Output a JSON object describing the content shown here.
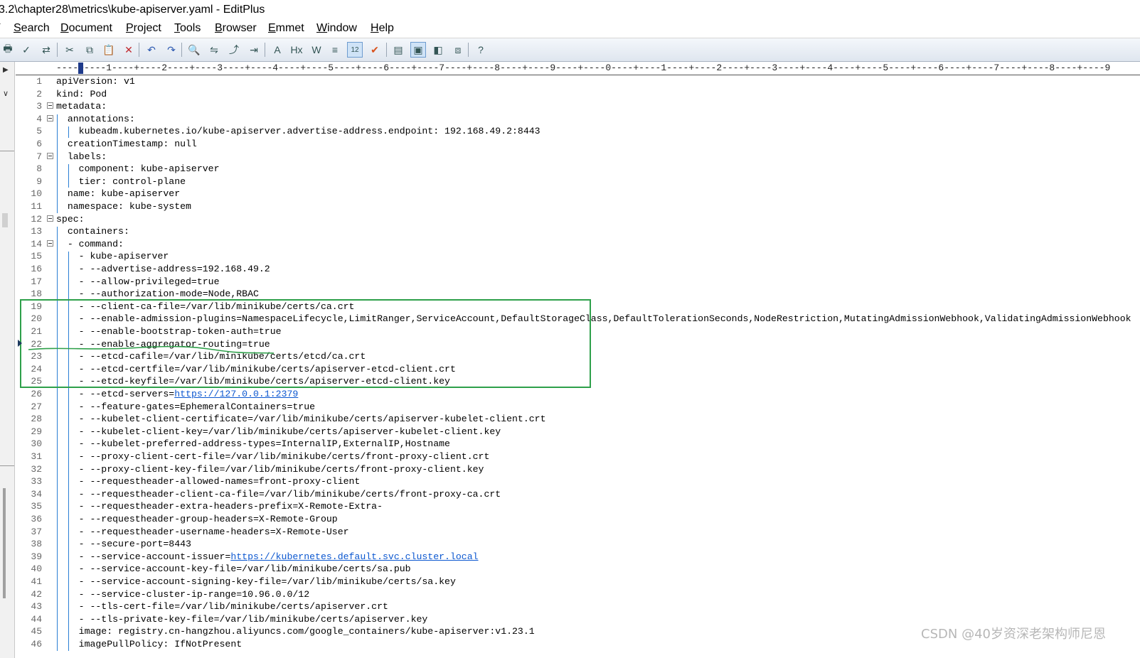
{
  "window": {
    "title": "3.2\\chapter28\\metrics\\kube-apiserver.yaml - EditPlus"
  },
  "menu": {
    "items": [
      {
        "label": "Search",
        "key": "S"
      },
      {
        "label": "Document",
        "key": "D"
      },
      {
        "label": "Project",
        "key": "P"
      },
      {
        "label": "Tools",
        "key": "T"
      },
      {
        "label": "Browser",
        "key": "B"
      },
      {
        "label": "Emmet",
        "key": "E"
      },
      {
        "label": "Window",
        "key": "W"
      },
      {
        "label": "Help",
        "key": "H"
      }
    ]
  },
  "toolbar": {
    "buttons": [
      {
        "name": "print-icon",
        "glyph": "🖶"
      },
      {
        "name": "spellcheck-icon",
        "glyph": "✓"
      },
      {
        "name": "sync-icon",
        "glyph": "⇄"
      },
      {
        "name": "cut-icon",
        "glyph": "✂"
      },
      {
        "name": "copy-icon",
        "glyph": "⧉"
      },
      {
        "name": "paste-icon",
        "glyph": "📋"
      },
      {
        "name": "delete-icon",
        "glyph": "✕"
      },
      {
        "name": "undo-icon",
        "glyph": "↶"
      },
      {
        "name": "redo-icon",
        "glyph": "↷"
      },
      {
        "name": "find-icon",
        "glyph": "🔍"
      },
      {
        "name": "replace-icon",
        "glyph": "⇋"
      },
      {
        "name": "goto-icon",
        "glyph": "⤴"
      },
      {
        "name": "indent-icon",
        "glyph": "⇥"
      },
      {
        "name": "font-icon",
        "glyph": "A"
      },
      {
        "name": "hex-icon",
        "glyph": "Hx"
      },
      {
        "name": "wordwrap-icon",
        "glyph": "W"
      },
      {
        "name": "linebreak-icon",
        "glyph": "≡"
      },
      {
        "name": "line-numbers-icon",
        "glyph": "12"
      },
      {
        "name": "check-icon",
        "glyph": "✔"
      },
      {
        "name": "view1-icon",
        "glyph": "▤"
      },
      {
        "name": "view2-icon",
        "glyph": "▣"
      },
      {
        "name": "view3-icon",
        "glyph": "◧"
      },
      {
        "name": "view4-icon",
        "glyph": "⧈"
      },
      {
        "name": "help-icon",
        "glyph": "?"
      }
    ]
  },
  "ruler": "----+----1----+----2----+----3----+----4----+----5----+----6----+----7----+----8----+----9----+----0----+----1----+----2----+----3----+----4----+----5----+----6----+----7----+----8----+----9",
  "editor": {
    "lines": [
      {
        "n": "1",
        "text": "apiVersion: v1"
      },
      {
        "n": "2",
        "text": "kind: Pod"
      },
      {
        "n": "3",
        "text": "metadata:"
      },
      {
        "n": "4",
        "text": "  annotations:"
      },
      {
        "n": "5",
        "text": "    kubeadm.kubernetes.io/kube-apiserver.advertise-address.endpoint: 192.168.49.2:8443"
      },
      {
        "n": "6",
        "text": "  creationTimestamp: null"
      },
      {
        "n": "7",
        "text": "  labels:"
      },
      {
        "n": "8",
        "text": "    component: kube-apiserver"
      },
      {
        "n": "9",
        "text": "    tier: control-plane"
      },
      {
        "n": "10",
        "text": "  name: kube-apiserver"
      },
      {
        "n": "11",
        "text": "  namespace: kube-system"
      },
      {
        "n": "12",
        "text": "spec:"
      },
      {
        "n": "13",
        "text": "  containers:"
      },
      {
        "n": "14",
        "text": "  - command:"
      },
      {
        "n": "15",
        "text": "    - kube-apiserver"
      },
      {
        "n": "16",
        "text": "    - --advertise-address=192.168.49.2"
      },
      {
        "n": "17",
        "text": "    - --allow-privileged=true"
      },
      {
        "n": "18",
        "text": "    - --authorization-mode=Node,RBAC"
      },
      {
        "n": "19",
        "text": "    - --client-ca-file=/var/lib/minikube/certs/ca.crt"
      },
      {
        "n": "20",
        "text": "    - --enable-admission-plugins=NamespaceLifecycle,LimitRanger,ServiceAccount,DefaultStorageClass,DefaultTolerationSeconds,NodeRestriction,MutatingAdmissionWebhook,ValidatingAdmissionWebhook"
      },
      {
        "n": "21",
        "text": "    - --enable-bootstrap-token-auth=true"
      },
      {
        "n": "22",
        "text": "    - --enable-aggregator-routing=true"
      },
      {
        "n": "23",
        "text": "    - --etcd-cafile=/var/lib/minikube/certs/etcd/ca.crt"
      },
      {
        "n": "24",
        "text": "    - --etcd-certfile=/var/lib/minikube/certs/apiserver-etcd-client.crt"
      },
      {
        "n": "25",
        "text": "    - --etcd-keyfile=/var/lib/minikube/certs/apiserver-etcd-client.key"
      },
      {
        "n": "26",
        "text": "    - --etcd-servers=",
        "link": "https://127.0.0.1:2379"
      },
      {
        "n": "27",
        "text": "    - --feature-gates=EphemeralContainers=true"
      },
      {
        "n": "28",
        "text": "    - --kubelet-client-certificate=/var/lib/minikube/certs/apiserver-kubelet-client.crt"
      },
      {
        "n": "29",
        "text": "    - --kubelet-client-key=/var/lib/minikube/certs/apiserver-kubelet-client.key"
      },
      {
        "n": "30",
        "text": "    - --kubelet-preferred-address-types=InternalIP,ExternalIP,Hostname"
      },
      {
        "n": "31",
        "text": "    - --proxy-client-cert-file=/var/lib/minikube/certs/front-proxy-client.crt"
      },
      {
        "n": "32",
        "text": "    - --proxy-client-key-file=/var/lib/minikube/certs/front-proxy-client.key"
      },
      {
        "n": "33",
        "text": "    - --requestheader-allowed-names=front-proxy-client"
      },
      {
        "n": "34",
        "text": "    - --requestheader-client-ca-file=/var/lib/minikube/certs/front-proxy-ca.crt"
      },
      {
        "n": "35",
        "text": "    - --requestheader-extra-headers-prefix=X-Remote-Extra-"
      },
      {
        "n": "36",
        "text": "    - --requestheader-group-headers=X-Remote-Group"
      },
      {
        "n": "37",
        "text": "    - --requestheader-username-headers=X-Remote-User"
      },
      {
        "n": "38",
        "text": "    - --secure-port=8443"
      },
      {
        "n": "39",
        "text": "    - --service-account-issuer=",
        "link": "https://kubernetes.default.svc.cluster.local"
      },
      {
        "n": "40",
        "text": "    - --service-account-key-file=/var/lib/minikube/certs/sa.pub"
      },
      {
        "n": "41",
        "text": "    - --service-account-signing-key-file=/var/lib/minikube/certs/sa.key"
      },
      {
        "n": "42",
        "text": "    - --service-cluster-ip-range=10.96.0.0/12"
      },
      {
        "n": "43",
        "text": "    - --tls-cert-file=/var/lib/minikube/certs/apiserver.crt"
      },
      {
        "n": "44",
        "text": "    - --tls-private-key-file=/var/lib/minikube/certs/apiserver.key"
      },
      {
        "n": "45",
        "text": "    image: registry.cn-hangzhou.aliyuncs.com/google_containers/kube-apiserver:v1.23.1"
      },
      {
        "n": "46",
        "text": "    imagePullPolicy: IfNotPresent"
      }
    ],
    "fold_lines": [
      "3",
      "4",
      "7",
      "12",
      "14"
    ]
  },
  "watermark": "CSDN @40岁资深老架构师尼恩",
  "colors": {
    "highlight_box": "#2ea04a",
    "link": "#0b57d0",
    "indent_guide": "#2a7fd4"
  }
}
